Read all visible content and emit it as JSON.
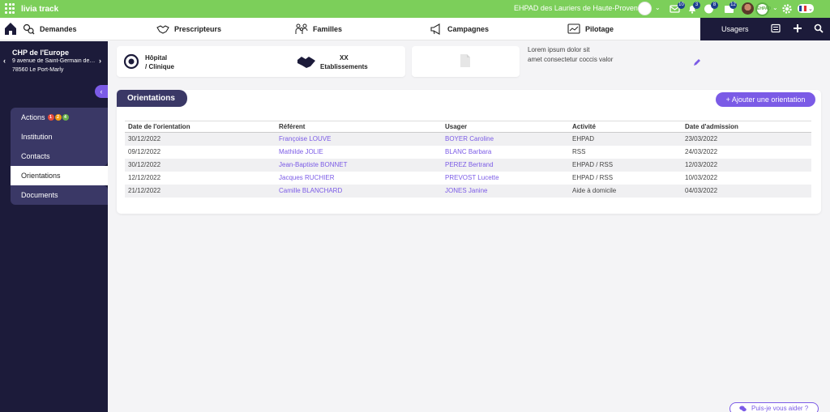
{
  "topbar": {
    "brand": "livia track",
    "site_name": "EHPAD des Lauriers de Haute-Provence",
    "avatar_label": "EHPAD",
    "badges": {
      "mail": "10",
      "bell": "3",
      "info": "8",
      "calendar": "12"
    }
  },
  "nav": {
    "items": [
      "Demandes",
      "Prescripteurs",
      "Familles",
      "Campagnes",
      "Pilotage"
    ],
    "usagers": "Usagers"
  },
  "sidebar": {
    "title": "CHP de l'Europe",
    "address_line1": "9 avenue de Saint-Germain des Près",
    "address_line2": "78560 Le Port-Marly",
    "menu": [
      "Actions",
      "Institution",
      "Contacts",
      "Orientations",
      "Documents"
    ],
    "action_counts": [
      "1",
      "2",
      "4"
    ],
    "action_count_colors": [
      "#e74c3c",
      "#f39c12",
      "#6ab04c"
    ]
  },
  "cards": {
    "type_line1": "Hôpital",
    "type_line2": "/ Clinique",
    "count_line1": "XX",
    "count_line2": "Etablissements",
    "lorem_line1": "Lorem ipsum dolor sit",
    "lorem_line2": "amet consectetur coccis valor"
  },
  "orientations": {
    "title": "Orientations",
    "add_label": "+ Ajouter une orientation",
    "columns": [
      "Date de l'orientation",
      "Référent",
      "Usager",
      "Activité",
      "Date d'admission"
    ],
    "rows": [
      [
        "30/12/2022",
        "Françoise LOUVE",
        "BOYER Caroline",
        "EHPAD",
        "23/03/2022"
      ],
      [
        "09/12/2022",
        "Mathilde JOLIE",
        "BLANC Barbara",
        "RSS",
        "24/03/2022"
      ],
      [
        "30/12/2022",
        "Jean-Baptiste BONNET",
        "PEREZ Bertrand",
        "EHPAD / RSS",
        "12/03/2022"
      ],
      [
        "12/12/2022",
        "Jacques RUCHIER",
        "PREVOST Lucette",
        "EHPAD / RSS",
        "10/03/2022"
      ],
      [
        "21/12/2022",
        "Camille BLANCHARD",
        "JONES Janine",
        "Aide à domicile",
        "04/03/2022"
      ]
    ]
  },
  "help": {
    "label": "Puis-je vous aider ?"
  },
  "colors": {
    "accent": "#7b5be6",
    "sidebar": "#1c1b3a",
    "topbar": "#7ccf5a"
  }
}
